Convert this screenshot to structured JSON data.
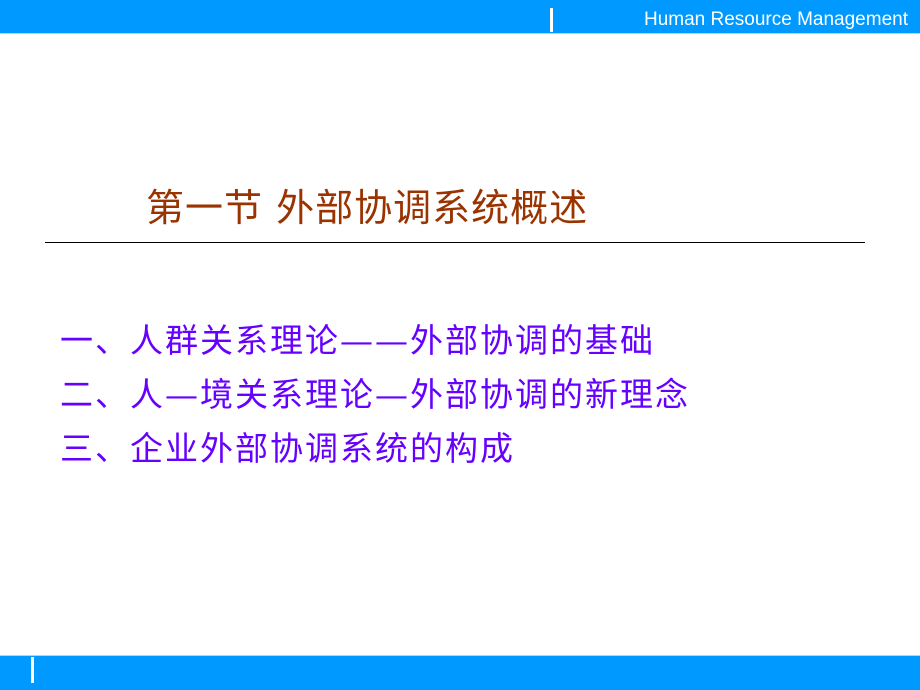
{
  "header": {
    "brand": "Human Resource Management",
    "bar_color": "#0099ff"
  },
  "slide": {
    "title": "第一节 外部协调系统概述",
    "title_color": "#993300",
    "items": [
      {
        "label": "一、人群关系理论——外部协调的基础"
      },
      {
        "label": "二、人—境关系理论—外部协调的新理念"
      },
      {
        "label": "三、企业外部协调系统的构成"
      }
    ],
    "item_color": "#6600ff"
  }
}
